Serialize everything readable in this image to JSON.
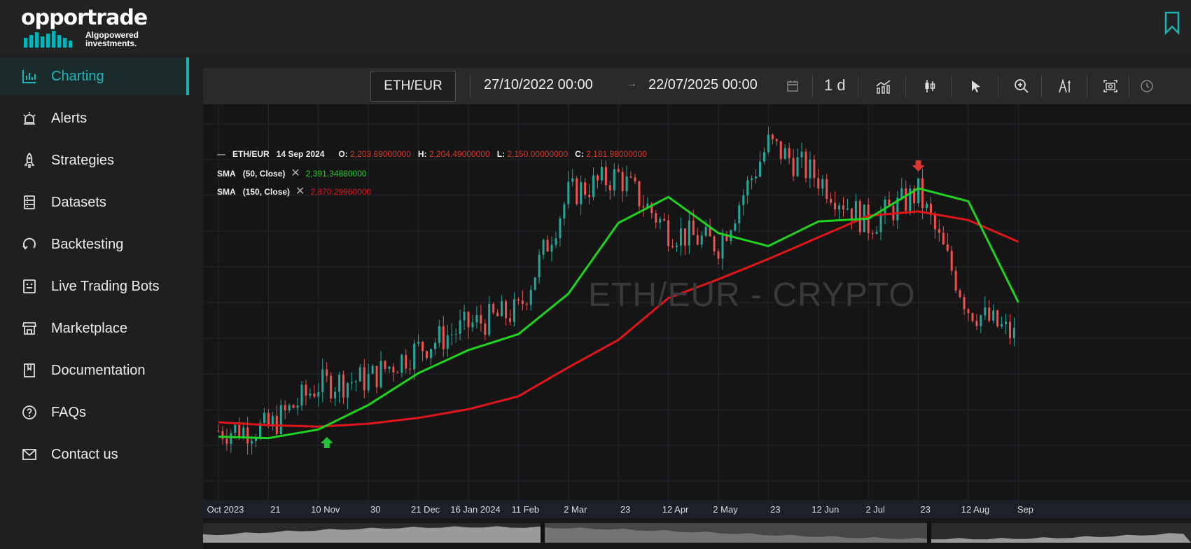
{
  "brand": {
    "name": "opportrade",
    "tagline_line1": "Algopowered",
    "tagline_line2": "investments."
  },
  "nav": {
    "items": [
      {
        "label": "Charting",
        "icon": "bar-chart-icon",
        "active": true
      },
      {
        "label": "Alerts",
        "icon": "siren-icon"
      },
      {
        "label": "Strategies",
        "icon": "rocket-icon"
      },
      {
        "label": "Datasets",
        "icon": "database-icon"
      },
      {
        "label": "Backtesting",
        "icon": "refresh-icon"
      },
      {
        "label": "Live Trading Bots",
        "icon": "robot-icon"
      },
      {
        "label": "Marketplace",
        "icon": "store-icon"
      },
      {
        "label": "Documentation",
        "icon": "book-icon"
      },
      {
        "label": "FAQs",
        "icon": "question-icon"
      },
      {
        "label": "Contact us",
        "icon": "mail-icon"
      }
    ]
  },
  "toolbar": {
    "pair": "ETH/EUR",
    "start_date": "27/10/2022 00:00",
    "arrow": "→",
    "end_date": "22/07/2025 00:00",
    "interval": "1 d"
  },
  "legend": {
    "symbol": "ETH/EUR",
    "date": "14 Sep 2024",
    "o_label": "O:",
    "o_value": "2,203.69000000",
    "h_label": "H:",
    "h_value": "2,204.49000000",
    "l_label": "L:",
    "l_value": "2,150.00000000",
    "c_label": "C:",
    "c_value": "2,181.98000000",
    "sma1_name": "SMA",
    "sma1_params": "(50, Close)",
    "sma1_value": "2,391.34880000",
    "sma2_name": "SMA",
    "sma2_params": "(150, Close)",
    "sma2_value": "2,870.29960000",
    "remove": "✕"
  },
  "watermark": "ETH/EUR - CRYPTO",
  "colors": {
    "accent": "#1ab3b5",
    "up": "#26a69a",
    "down": "#ef5350",
    "sma50": "#1ed41e",
    "sma150": "#e0161a"
  },
  "xaxis_ticks": [
    "Oct 2023",
    "21",
    "10 Nov",
    "30",
    "21 Dec",
    "16 Jan 2024",
    "11 Feb",
    "2 Mar",
    "23",
    "12 Apr",
    "2 May",
    "23",
    "12 Jun",
    "2 Jul",
    "23",
    "12 Aug",
    "Sep"
  ],
  "chart_data": {
    "type": "line",
    "title": "ETH/EUR - CRYPTO",
    "x": [
      "Oct 2023",
      "21",
      "10 Nov",
      "30",
      "21 Dec",
      "16 Jan 2024",
      "11 Feb",
      "2 Mar",
      "23",
      "12 Apr",
      "2 May",
      "23",
      "12 Jun",
      "2 Jul",
      "23",
      "12 Aug",
      "Sep"
    ],
    "series": [
      {
        "name": "ETH/EUR",
        "values": [
          1560,
          1580,
          1880,
          1920,
          2130,
          2290,
          2390,
          3200,
          3330,
          2950,
          2850,
          3550,
          3310,
          2990,
          3210,
          2410,
          2200
        ]
      },
      {
        "name": "SMA (50, Close)",
        "values": [
          1520,
          1510,
          1570,
          1740,
          1960,
          2120,
          2230,
          2510,
          3000,
          3180,
          2930,
          2840,
          3010,
          3030,
          3240,
          3150,
          2450
        ]
      },
      {
        "name": "SMA (150, Close)",
        "values": [
          1620,
          1600,
          1590,
          1610,
          1650,
          1710,
          1800,
          2000,
          2190,
          2480,
          2610,
          2750,
          2900,
          3050,
          3080,
          3020,
          2870
        ]
      }
    ],
    "markers": [
      {
        "type": "buy",
        "x": "10 Nov"
      },
      {
        "type": "sell",
        "x": "23"
      }
    ]
  }
}
